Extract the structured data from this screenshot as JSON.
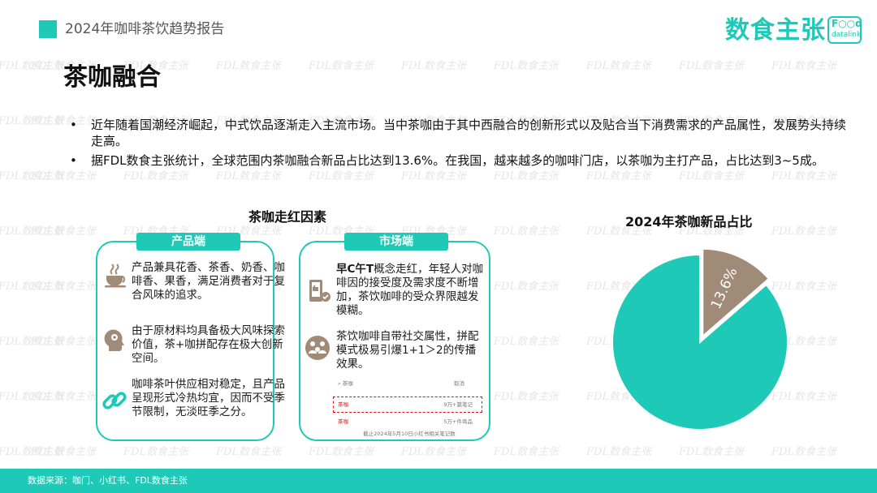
{
  "header": {
    "report_title": "2024年咖啡茶饮趋势报告",
    "logo_text": "数食主张",
    "logo_badge_line1": "F○○d",
    "logo_badge_line2": "datalink"
  },
  "watermark": "FDL数食主张",
  "page_title": "茶咖融合",
  "bullets": [
    "近年随着国潮经济崛起，中式饮品逐渐走入主流市场。当中茶咖由于其中西融合的创新形式以及贴合当下消费需求的产品属性，发展势头持续走高。",
    "据FDL数食主张统计，全球范围内茶咖融合新品占比达到13.6%。在我国，越来越多的咖啡门店，以茶咖为主打产品，占比达到3~5成。"
  ],
  "bullet_symbol": "•",
  "factors": {
    "title": "茶咖走红因素",
    "product": {
      "tab": "产品端",
      "items": [
        {
          "icon": "coffee-cup-icon",
          "text": "产品兼具花香、茶香、奶香、咖啡香、果香，满足消费者对于复合风味的追求。"
        },
        {
          "icon": "head-gears-icon",
          "text": "由于原材料均具备极大风味探索价值，茶+咖拼配存在极大创新空间。"
        },
        {
          "icon": "chain-link-icon",
          "text": "咖啡茶叶供应相对稳定，且产品呈现形式冷热均宜，因而不受季节限制，无淡旺季之分。"
        }
      ]
    },
    "market": {
      "tab": "市场端",
      "items": [
        {
          "icon": "phone-like-icon",
          "text_bold": "早C午T",
          "text": "概念走红，年轻人对咖啡因的接受度及需求度不断增加，茶饮咖啡的受众界限越发模糊。"
        },
        {
          "icon": "social-group-icon",
          "text": "茶饮咖啡自带社交属性，拼配模式极易引爆1+1＞2的传播效果。"
        }
      ],
      "search_mock": {
        "query": "茶咖",
        "cancel": "取消",
        "result1": "茶咖",
        "result1_count": "9万+篇笔记",
        "result2": "茶咖",
        "result2_count": "5万+件商品",
        "caption": "截止2024年5月10日小红书相关笔记数"
      }
    }
  },
  "chart_data": {
    "type": "pie",
    "title": "2024年茶咖新品占比",
    "slices": [
      {
        "label": "13.6%",
        "value": 13.6,
        "color": "#a08a78"
      },
      {
        "label": "",
        "value": 86.4,
        "color": "#1ec9b7"
      }
    ],
    "start_angle_deg": 0,
    "exploded_slice": 0
  },
  "footer": {
    "source": "数据来源：咖门、小红书、FDL数食主张"
  },
  "colors": {
    "accent": "#1ec9b7",
    "pie_highlight": "#a08a78",
    "icon_brown": "#a08a78"
  }
}
